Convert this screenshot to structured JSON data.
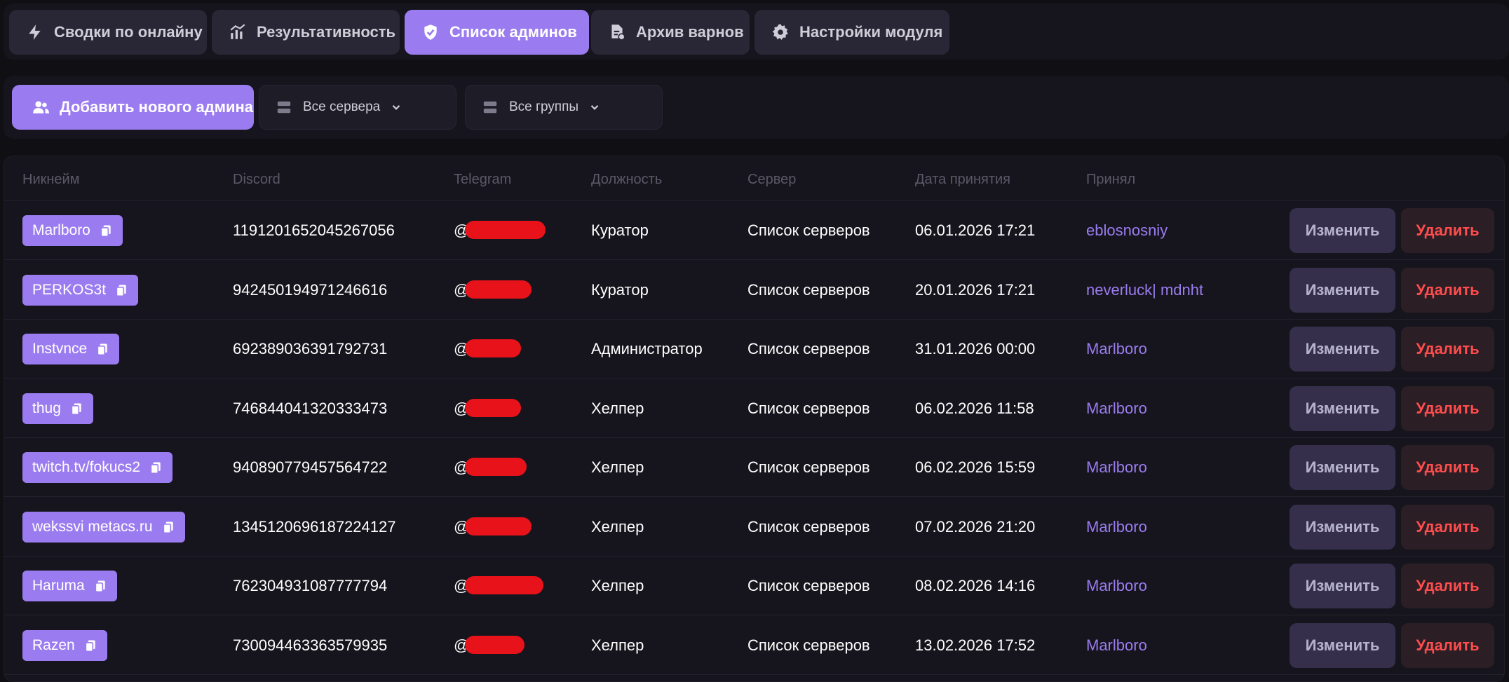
{
  "tabs": [
    {
      "label": "Сводки по онлайну",
      "icon": "lightning-icon"
    },
    {
      "label": "Результативность",
      "icon": "chart-icon"
    },
    {
      "label": "Список админов",
      "icon": "shield-icon",
      "active": true
    },
    {
      "label": "Архив варнов",
      "icon": "document-archive-icon"
    },
    {
      "label": "Настройки модуля",
      "icon": "gear-icon"
    }
  ],
  "filters": {
    "add_label": "Добавить нового админа",
    "servers_label": "Все сервера",
    "groups_label": "Все группы"
  },
  "table": {
    "headers": [
      "Никнейм",
      "Discord",
      "Telegram",
      "Должность",
      "Сервер",
      "Дата принятия",
      "Принял"
    ],
    "edit_label": "Изменить",
    "delete_label": "Удалить",
    "rows": [
      {
        "nick": "Marlboro",
        "discord": "1191201652045267056",
        "telegram": "@",
        "role": "Куратор",
        "server": "Список серверов",
        "date": "06.01.2026 17:21",
        "accepted_by": "eblosnosniy"
      },
      {
        "nick": "PERKOS3t",
        "discord": "942450194971246616",
        "telegram": "@",
        "role": "Куратор",
        "server": "Список серверов",
        "date": "20.01.2026 17:21",
        "accepted_by": "neverluck| mdnht"
      },
      {
        "nick": "Instvnce",
        "discord": "692389036391792731",
        "telegram": "@",
        "role": "Администратор",
        "server": "Список серверов",
        "date": "31.01.2026 00:00",
        "accepted_by": "Marlboro"
      },
      {
        "nick": "thug",
        "discord": "746844041320333473",
        "telegram": "@",
        "role": "Хелпер",
        "server": "Список серверов",
        "date": "06.02.2026 11:58",
        "accepted_by": "Marlboro"
      },
      {
        "nick": "twitch.tv/fokucs2",
        "discord": "940890779457564722",
        "telegram": "@",
        "role": "Хелпер",
        "server": "Список серверов",
        "date": "06.02.2026 15:59",
        "accepted_by": "Marlboro"
      },
      {
        "nick": "wekssvi metacs.ru",
        "discord": "1345120696187224127",
        "telegram": "@",
        "role": "Хелпер",
        "server": "Список серверов",
        "date": "07.02.2026 21:20",
        "accepted_by": "Marlboro"
      },
      {
        "nick": "Haruma",
        "discord": "762304931087777794",
        "telegram": "@",
        "role": "Хелпер",
        "server": "Список серверов",
        "date": "08.02.2026 14:16",
        "accepted_by": "Marlboro"
      },
      {
        "nick": "Razen",
        "discord": "730094463363579935",
        "telegram": "@",
        "role": "Хелпер",
        "server": "Список серверов",
        "date": "13.02.2026 17:52",
        "accepted_by": "Marlboro"
      }
    ]
  },
  "colors": {
    "accent": "#9b7cf0",
    "background": "#0f0f14",
    "panel": "#16151d",
    "danger": "#ff4d4d"
  }
}
